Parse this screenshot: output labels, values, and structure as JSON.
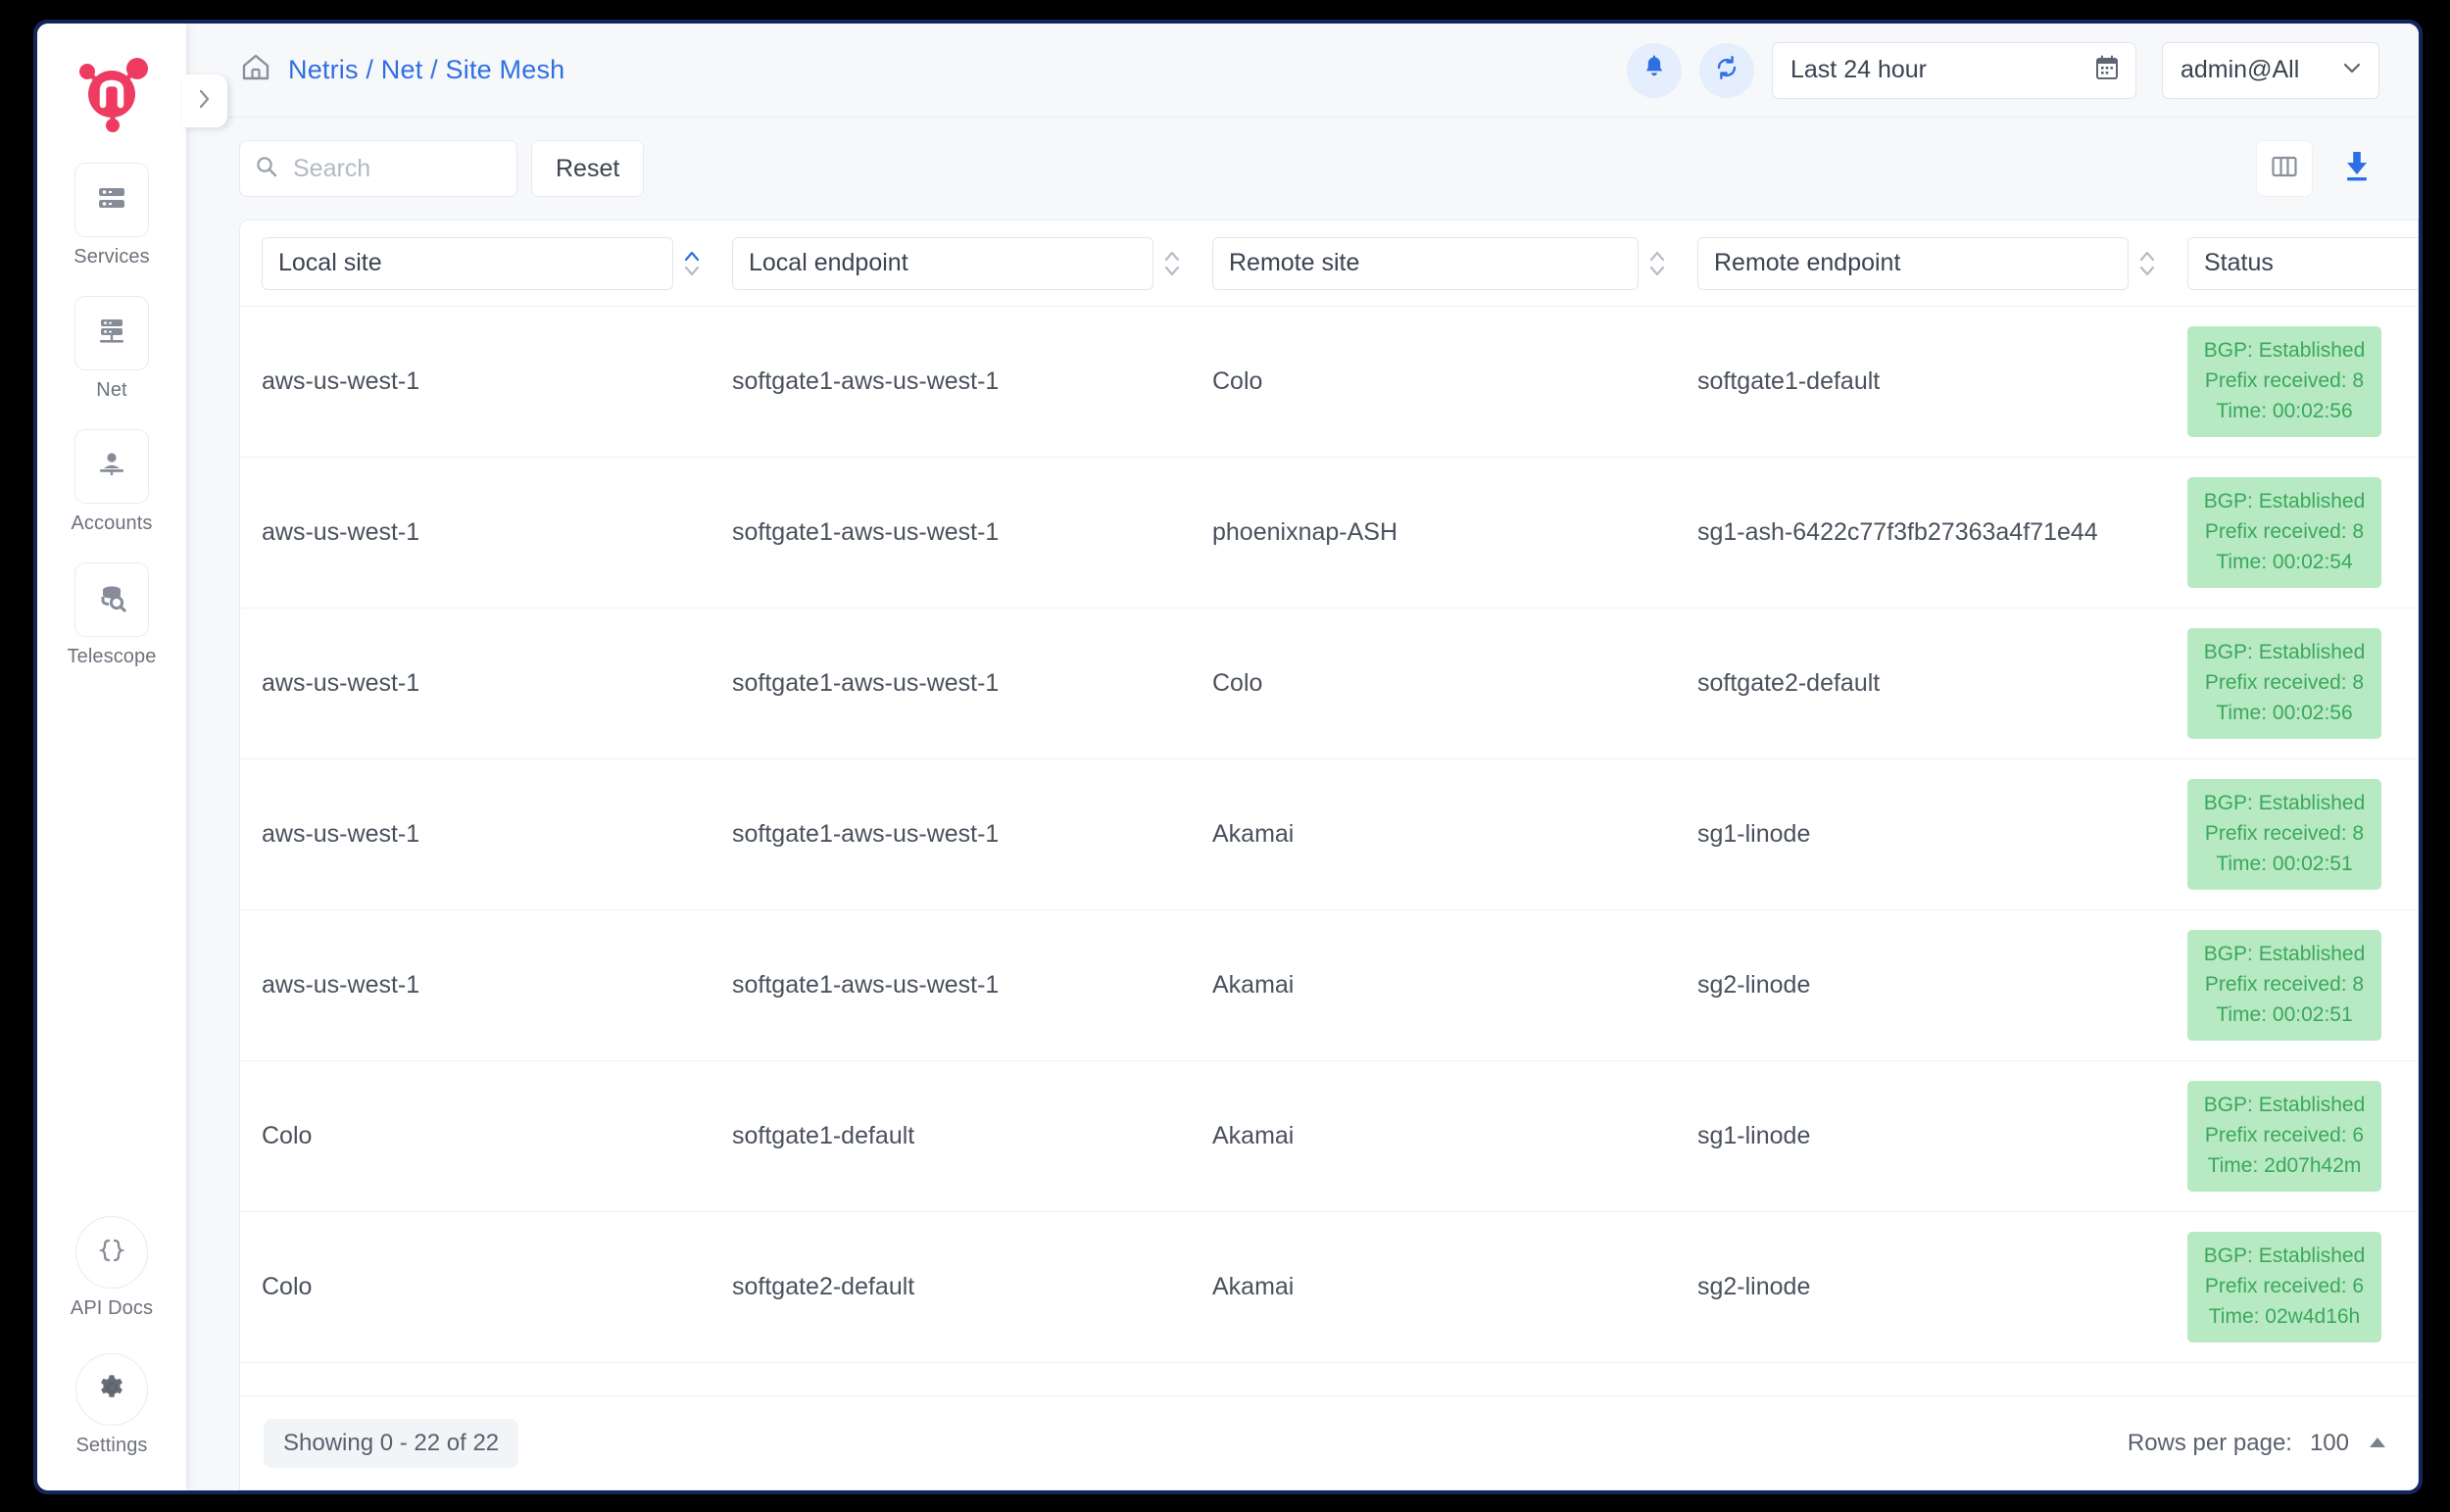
{
  "colors": {
    "accent_blue": "#2f6fe4",
    "frame_navy": "#13265c",
    "status_green_bg": "#b7e9c3",
    "status_green_text": "#3ba85c",
    "logo_pink": "#ef3b62"
  },
  "sidebar": {
    "logo_name": "netris-logo",
    "collapse_label": "›",
    "items": [
      {
        "label": "Services",
        "icon": "servers-icon"
      },
      {
        "label": "Net",
        "icon": "network-icon"
      },
      {
        "label": "Accounts",
        "icon": "accounts-icon"
      },
      {
        "label": "Telescope",
        "icon": "telescope-icon"
      }
    ],
    "bottom_items": [
      {
        "label": "API Docs",
        "icon": "braces-icon"
      },
      {
        "label": "Settings",
        "icon": "gear-icon"
      }
    ]
  },
  "header": {
    "breadcrumb": "Netris / Net / Site Mesh",
    "home_icon": "home-icon",
    "notifications_icon": "bell-icon",
    "refresh_icon": "refresh-icon",
    "date_range": "Last 24 hour",
    "calendar_icon": "calendar-icon",
    "account": "admin@All",
    "account_chevron": "chevron-down-icon"
  },
  "toolbar": {
    "search_placeholder": "Search",
    "search_value": "",
    "search_icon": "search-icon",
    "reset_label": "Reset",
    "columns_icon": "columns-icon",
    "download_icon": "download-icon"
  },
  "table": {
    "columns": [
      {
        "label": "Local site",
        "sort": "asc"
      },
      {
        "label": "Local endpoint",
        "sort": "none"
      },
      {
        "label": "Remote site",
        "sort": "none"
      },
      {
        "label": "Remote endpoint",
        "sort": "none"
      },
      {
        "label": "Status",
        "sort": "none"
      }
    ],
    "rows": [
      {
        "local_site": "aws-us-west-1",
        "local_endpoint": "softgate1-aws-us-west-1",
        "remote_site": "Colo",
        "remote_endpoint": "softgate1-default",
        "status": [
          "BGP: Established",
          "Prefix received: 8",
          "Time: 00:02:56"
        ]
      },
      {
        "local_site": "aws-us-west-1",
        "local_endpoint": "softgate1-aws-us-west-1",
        "remote_site": "phoenixnap-ASH",
        "remote_endpoint": "sg1-ash-6422c77f3fb27363a4f71e44",
        "status": [
          "BGP: Established",
          "Prefix received: 8",
          "Time: 00:02:54"
        ]
      },
      {
        "local_site": "aws-us-west-1",
        "local_endpoint": "softgate1-aws-us-west-1",
        "remote_site": "Colo",
        "remote_endpoint": "softgate2-default",
        "status": [
          "BGP: Established",
          "Prefix received: 8",
          "Time: 00:02:56"
        ]
      },
      {
        "local_site": "aws-us-west-1",
        "local_endpoint": "softgate1-aws-us-west-1",
        "remote_site": "Akamai",
        "remote_endpoint": "sg1-linode",
        "status": [
          "BGP: Established",
          "Prefix received: 8",
          "Time: 00:02:51"
        ]
      },
      {
        "local_site": "aws-us-west-1",
        "local_endpoint": "softgate1-aws-us-west-1",
        "remote_site": "Akamai",
        "remote_endpoint": "sg2-linode",
        "status": [
          "BGP: Established",
          "Prefix received: 8",
          "Time: 00:02:51"
        ]
      },
      {
        "local_site": "Colo",
        "local_endpoint": "softgate1-default",
        "remote_site": "Akamai",
        "remote_endpoint": "sg1-linode",
        "status": [
          "BGP: Established",
          "Prefix received: 6",
          "Time: 2d07h42m"
        ]
      },
      {
        "local_site": "Colo",
        "local_endpoint": "softgate2-default",
        "remote_site": "Akamai",
        "remote_endpoint": "sg2-linode",
        "status": [
          "BGP: Established",
          "Prefix received: 6",
          "Time: 02w4d16h"
        ]
      }
    ]
  },
  "footer": {
    "showing": "Showing 0 - 22 of 22",
    "rows_per_page_label": "Rows per page:",
    "rows_per_page_value": "100",
    "rows_per_page_chevron": "chevron-up-icon"
  }
}
